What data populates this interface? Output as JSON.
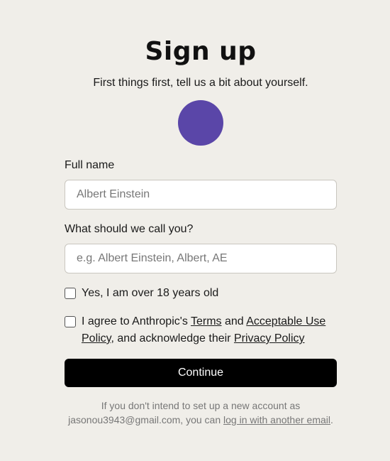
{
  "header": {
    "title": "Sign up",
    "subtitle": "First things first, tell us a bit about yourself."
  },
  "avatar": {
    "color": "#5a46a8"
  },
  "form": {
    "full_name": {
      "label": "Full name",
      "placeholder": "Albert Einstein",
      "value": ""
    },
    "nickname": {
      "label": "What should we call you?",
      "placeholder": "e.g. Albert Einstein, Albert, AE",
      "value": ""
    },
    "age_check": {
      "label": "Yes, I am over 18 years old",
      "checked": false
    },
    "terms_check": {
      "checked": false,
      "text_1": "I agree to Anthropic's ",
      "terms_link": "Terms",
      "text_2": " and ",
      "aup_link": "Acceptable Use Policy",
      "text_3": ", and acknowledge their ",
      "privacy_link": "Privacy Policy"
    },
    "continue_label": "Continue"
  },
  "footer": {
    "text_1": "If you don't intend to set up a new account as jasonou3943@gmail.com, you can ",
    "login_link": "log in with another email",
    "text_2": "."
  }
}
